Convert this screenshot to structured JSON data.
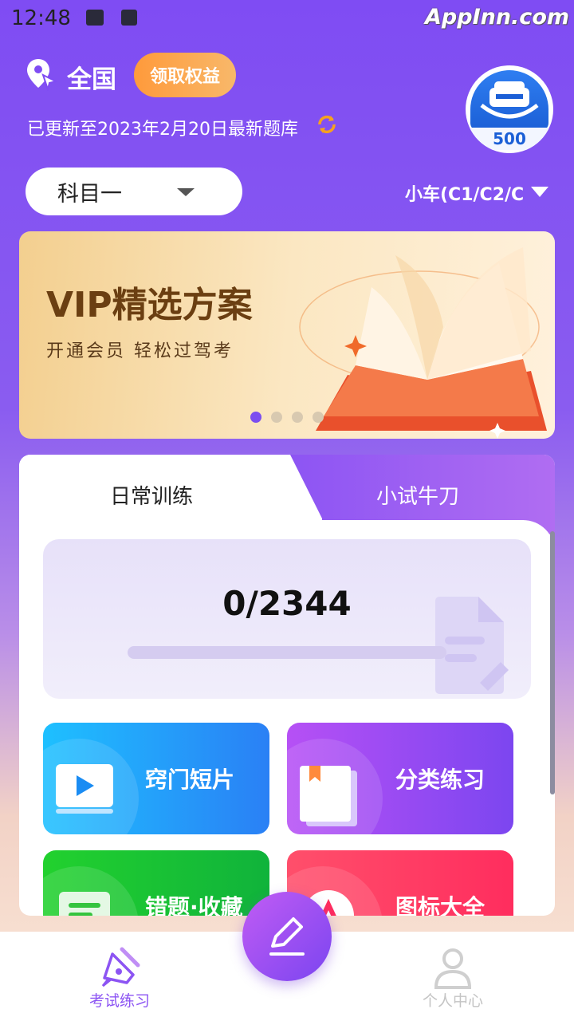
{
  "status_bar": {
    "time": "12:48",
    "watermark": "AppInn.com"
  },
  "header": {
    "location": "全国",
    "rights_button": "领取权益",
    "update_text": "已更新至2023年2月20日最新题库",
    "badge_number": "500"
  },
  "subject": {
    "selected": "科目一"
  },
  "car_type": "小车(C1/C2/C",
  "banner": {
    "title": "VIP精选方案",
    "subtitle": "开通会员  轻松过驾考",
    "page_count": 4,
    "active_page": 1
  },
  "practice": {
    "tabs": [
      {
        "label": "日常训练",
        "active": false
      },
      {
        "label": "小试牛刀",
        "active": true
      }
    ],
    "progress_text": "0/2344",
    "progress_fraction": 0,
    "tiles": [
      {
        "label": "窍门短片",
        "icon": "video-play-icon"
      },
      {
        "label": "分类练习",
        "icon": "book-icon"
      },
      {
        "label": "错题·收藏",
        "icon": "notebook-icon"
      },
      {
        "label": "图标大全",
        "icon": "traffic-sign-icon"
      }
    ]
  },
  "bottom_nav": {
    "items": [
      {
        "label": "考试练习",
        "active": true,
        "icon": "pen-nib-icon"
      },
      {
        "label": "个人中心",
        "active": false,
        "icon": "user-icon"
      }
    ],
    "center_icon": "edit-pencil-icon"
  },
  "colors": {
    "accent": "#8c54f3",
    "header_bg": "#7f4cf3",
    "rights_button": "#ff9a3b"
  }
}
